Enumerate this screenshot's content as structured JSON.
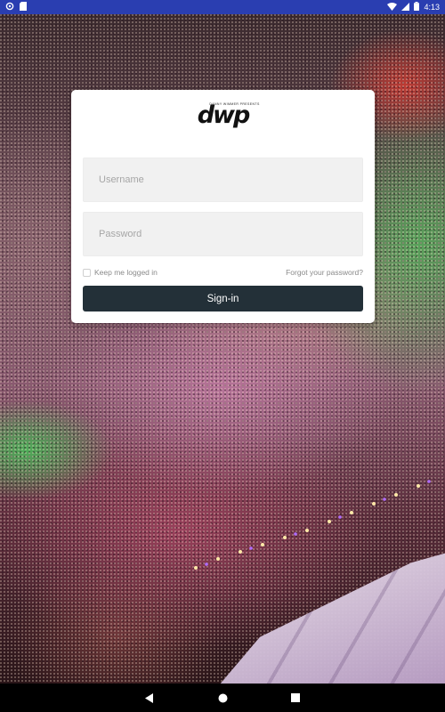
{
  "status_bar": {
    "time": "4:13",
    "left_icons": [
      "settings-icon",
      "sd-card-icon"
    ],
    "right_icons": [
      "wifi-icon",
      "cellular-icon",
      "battery-icon"
    ],
    "background_color": "#2a3eb1"
  },
  "logo": {
    "tagline": "DANNY WIMMER PRESENTS",
    "mark": "dwp"
  },
  "login": {
    "username_placeholder": "Username",
    "password_placeholder": "Password",
    "remember_label": "Keep me logged in",
    "remember_checked": false,
    "forgot_label": "Forgot your password?",
    "signin_label": "Sign-in",
    "button_color": "#233038"
  },
  "nav_bar": {
    "buttons": [
      "back-icon",
      "home-icon",
      "recents-icon"
    ]
  }
}
